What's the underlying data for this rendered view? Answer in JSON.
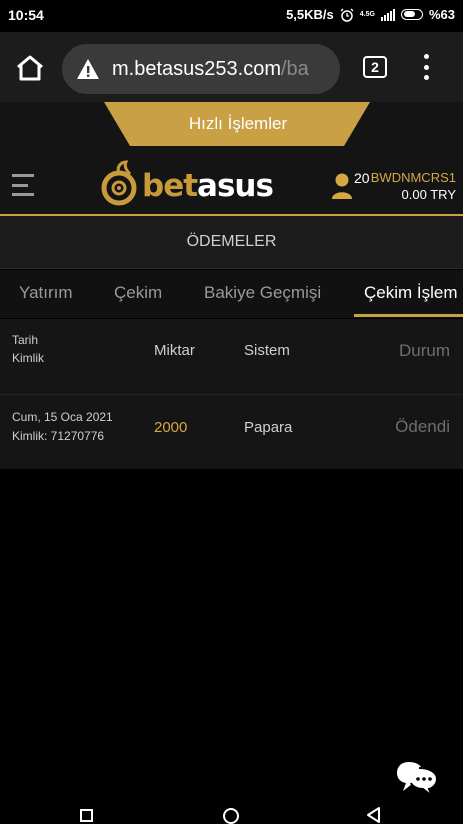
{
  "status_bar": {
    "time": "10:54",
    "net_speed": "5,5KB/s",
    "network_type": "4.5G",
    "battery": "%63",
    "icons": [
      "alarm-icon",
      "signal-icon",
      "battery-icon"
    ]
  },
  "browser": {
    "url_main": "m.betasus253.com",
    "url_path": "/ba",
    "tab_count": "2",
    "icons": [
      "home-icon",
      "warning-icon",
      "tab-switcher-icon",
      "menu-dots-icon"
    ]
  },
  "header": {
    "quick_actions_label": "Hızlı İşlemler",
    "logo_bet": "bet",
    "logo_asus": "asus",
    "user_count": "20",
    "username": "BWDNMCRS1",
    "balance": "0.00 TRY",
    "accent_color": "#c9a043"
  },
  "page": {
    "section_title": "ÖDEMELER"
  },
  "tabs": [
    {
      "label": "Yatırım",
      "active": false
    },
    {
      "label": "Çekim",
      "active": false
    },
    {
      "label": "Bakiye Geçmişi",
      "active": false
    },
    {
      "label": "Çekim İşlem",
      "active": true
    }
  ],
  "table": {
    "headers": {
      "date": "Tarih",
      "id": "Kimlik",
      "amount": "Miktar",
      "system": "Sistem",
      "status": "Durum"
    },
    "rows": [
      {
        "date": "Cum, 15 Oca 2021",
        "id": "Kimlik: 71270776",
        "amount": "2000",
        "system": "Papara",
        "status": "Ödendi"
      }
    ]
  }
}
